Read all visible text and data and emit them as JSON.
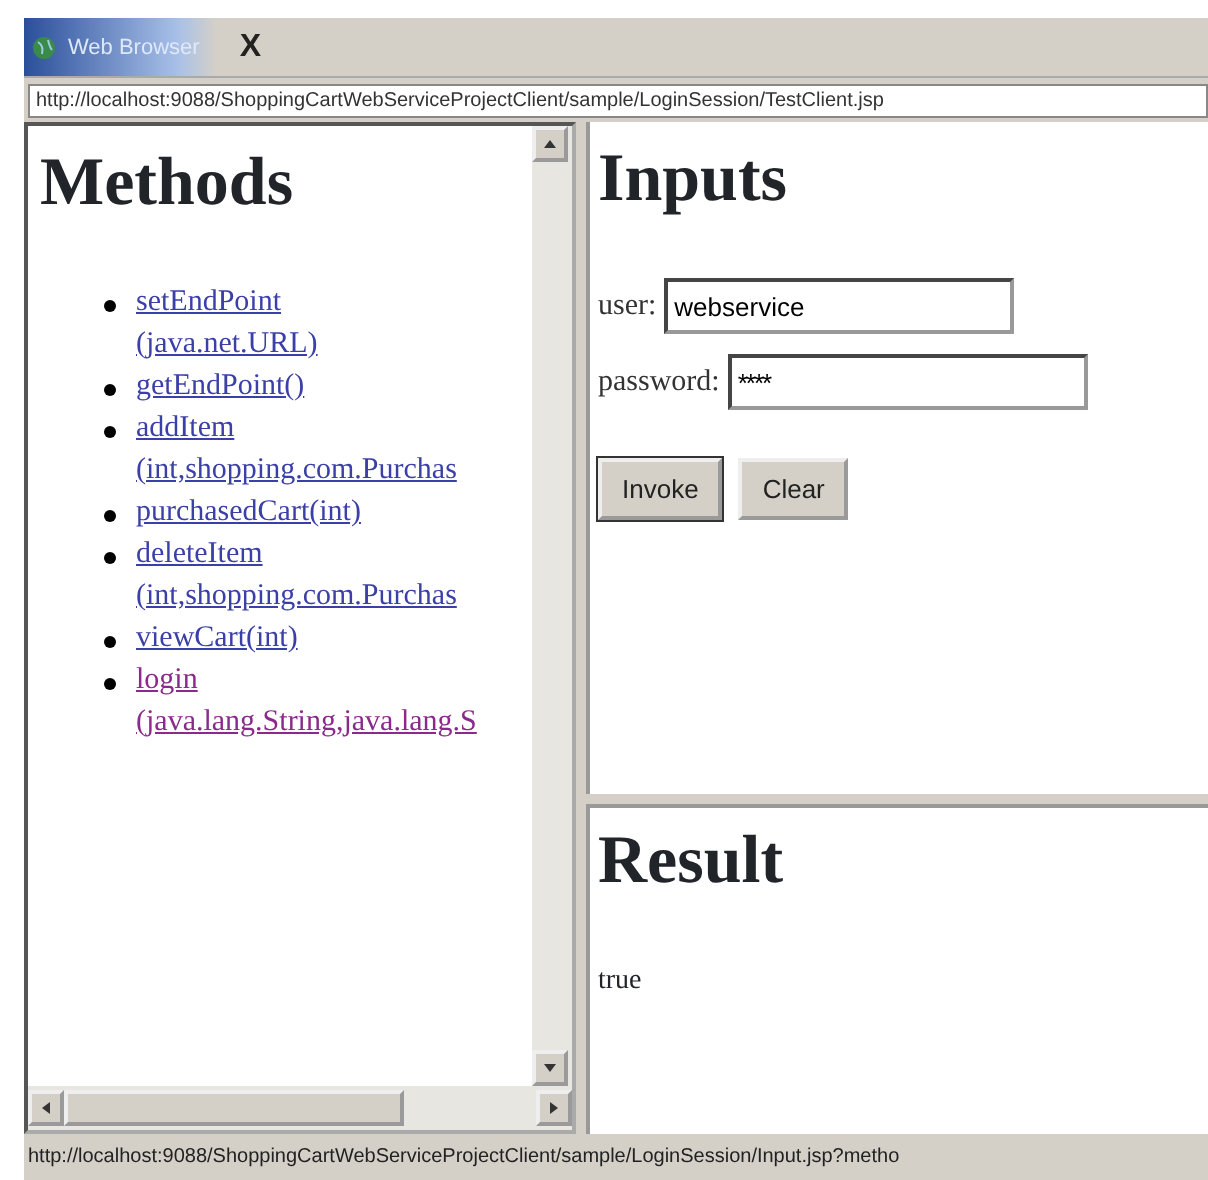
{
  "tabs": [
    {
      "label": "Web Browser",
      "close": "X",
      "selected": true
    }
  ],
  "address": "http://localhost:9088/ShoppingCartWebServiceProjectClient/sample/LoginSession/TestClient.jsp",
  "methods": {
    "title": "Methods",
    "items": [
      {
        "name": "setEndPoint",
        "params": "(java.net.URL)",
        "visited": false
      },
      {
        "name": "getEndPoint()",
        "visited": false
      },
      {
        "name": "addItem",
        "params": "(int,shopping.com.Purchas",
        "visited": false
      },
      {
        "name": "purchasedCart(int)",
        "visited": false
      },
      {
        "name": "deleteItem",
        "params": "(int,shopping.com.Purchas",
        "visited": false
      },
      {
        "name": "viewCart(int)",
        "visited": false
      },
      {
        "name": "login",
        "params": "(java.lang.String,java.lang.S",
        "visited": true
      }
    ]
  },
  "inputs": {
    "title": "Inputs",
    "fields": [
      {
        "label": "user:",
        "value": "webservice",
        "kind": "text"
      },
      {
        "label": "password:",
        "value": "****",
        "kind": "password"
      }
    ],
    "buttons": [
      {
        "label": "Invoke",
        "focused": true
      },
      {
        "label": "Clear",
        "focused": false
      }
    ]
  },
  "result": {
    "title": "Result",
    "value": "true"
  },
  "status_bar": "http://localhost:9088/ShoppingCartWebServiceProjectClient/sample/LoginSession/Input.jsp?metho"
}
